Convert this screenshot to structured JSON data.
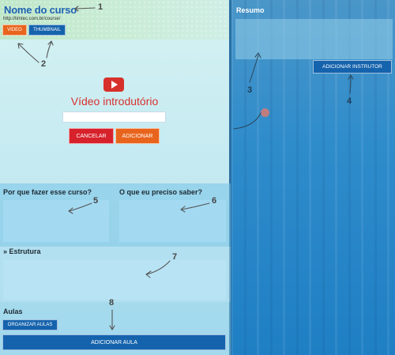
{
  "header": {
    "title": "Nome do curso",
    "url": "http://timtec.com.br/course/",
    "video_button": "VIDEO",
    "thumbnail_button": "THUMBNAIL"
  },
  "video": {
    "title": "Vídeo introdutório",
    "input_value": "",
    "cancel_button": "CANCELAR",
    "add_button": "ADICIONAR"
  },
  "sections": {
    "why_title": "Por que fazer esse curso?",
    "requirements_title": "O que eu preciso saber?",
    "structure_title": "» Estrutura",
    "lessons_title": "Aulas",
    "organize_button": "ORGANIZAR AULAS",
    "add_lesson_button": "ADICIONAR AULA"
  },
  "sidebar": {
    "resumo_label": "Resumo",
    "add_instructor_button": "ADICIONAR INSTRUTOR"
  },
  "annotations": [
    "1",
    "2",
    "3",
    "4",
    "5",
    "6",
    "7",
    "8"
  ],
  "colors": {
    "title_blue": "#1f62b3",
    "orange": "#e8641c",
    "button_blue": "#1563ad",
    "red": "#d7212b",
    "sidebar_blue": "#2f8ccb"
  },
  "icons": [
    "youtube-play-icon",
    "annotation-arrow-icon"
  ]
}
